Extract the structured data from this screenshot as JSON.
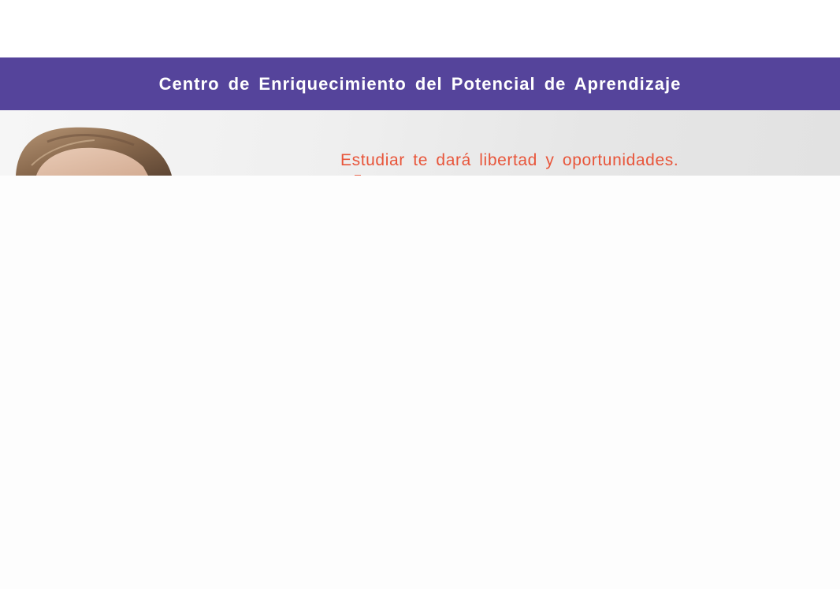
{
  "header": {
    "title": "Centro de Enriquecimiento del Potencial de Aprendizaje"
  },
  "hero": {
    "headline": "Estudiar te dará libertad y oportunidades."
  },
  "colors": {
    "header_bg": "#55449b",
    "header_text": "#ffffff",
    "headline_text": "#e8553a"
  }
}
